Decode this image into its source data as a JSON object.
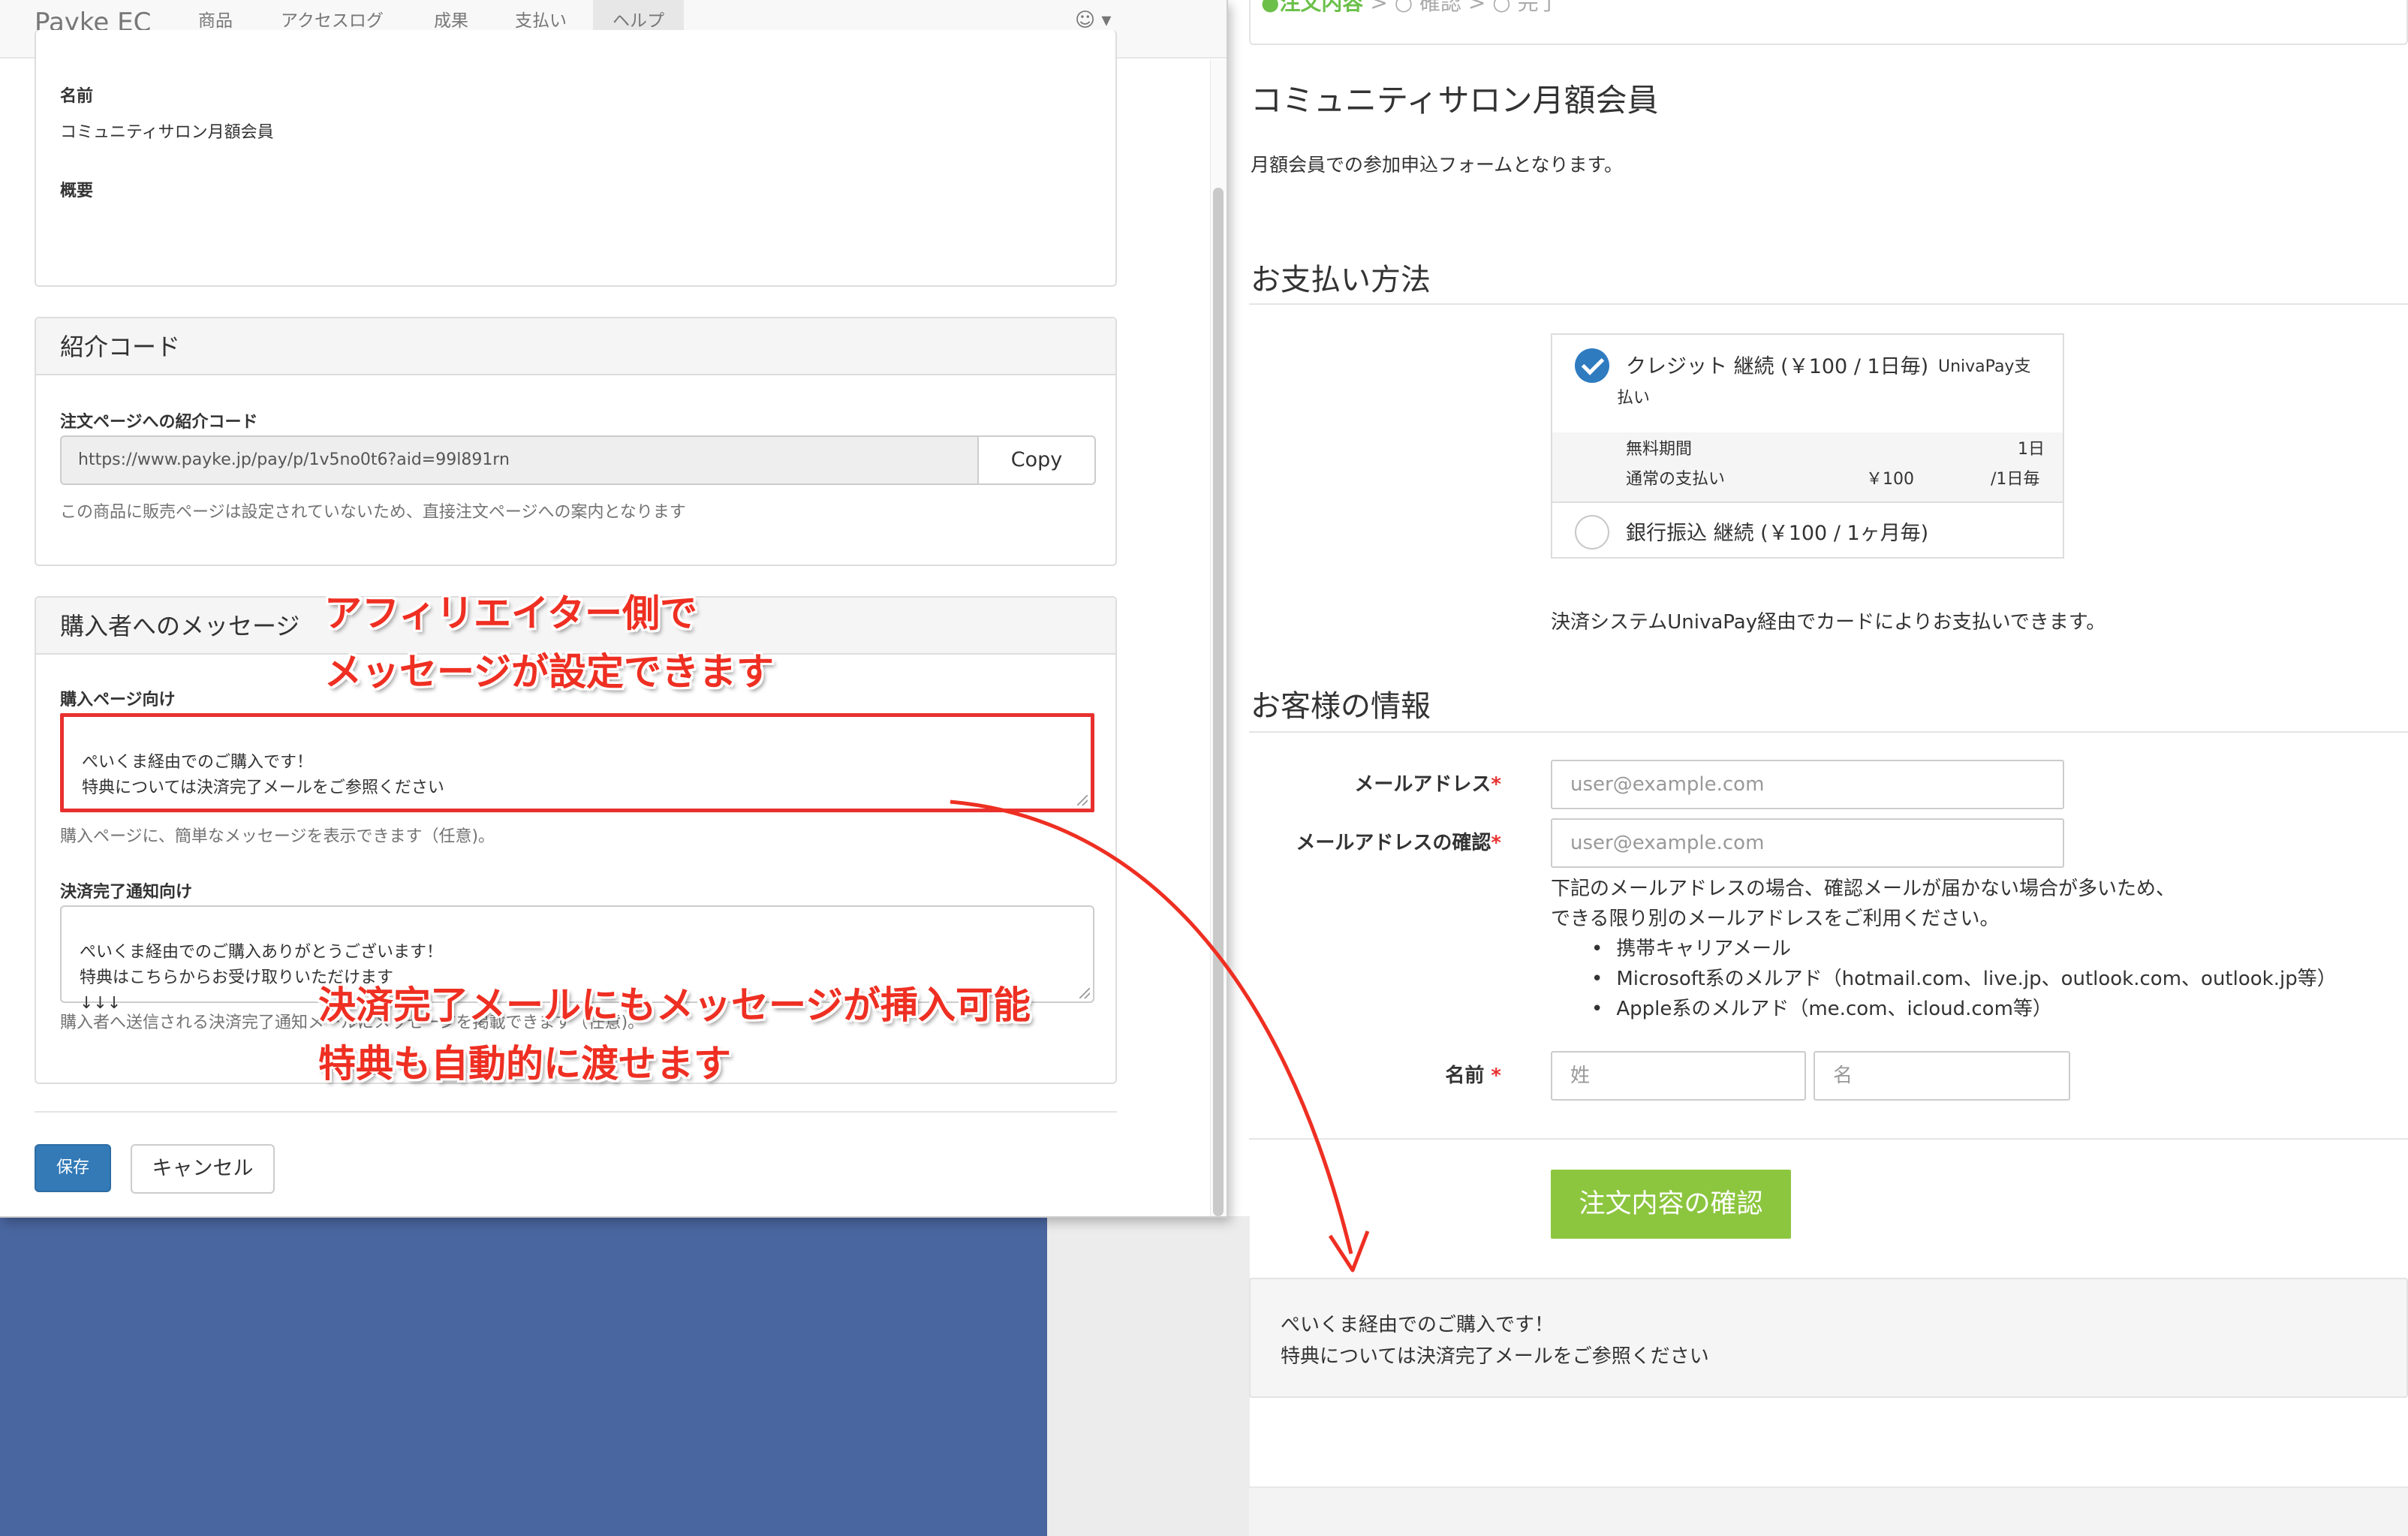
{
  "admin": {
    "brand": "Payke EC",
    "nav": [
      "商品",
      "アクセスログ",
      "成果",
      "支払い",
      "ヘルプ"
    ],
    "user_menu": "☺ ▾",
    "product": {
      "name_label": "名前",
      "name_value": "コミュニティサロン月額会員",
      "summary_label": "概要"
    },
    "referral": {
      "heading": "紹介コード",
      "order_page_label": "注文ページへの紹介コード",
      "url": "https://www.payke.jp/pay/p/1v5no0t6?aid=99l891rn",
      "copy_label": "Copy",
      "help": "この商品に販売ページは設定されていないため、直接注文ページへの案内となります"
    },
    "buyer_message": {
      "heading": "購入者へのメッセージ",
      "purchase_label": "購入ページ向け",
      "purchase_text": "ぺいくま経由でのご購入です！\n特典については決済完了メールをご参照ください",
      "purchase_help": "購入ページに、簡単なメッセージを表示できます（任意)。",
      "completion_label": "決済完了通知向け",
      "completion_text": "ぺいくま経由でのご購入ありがとうございます！\n特典はこちらからお受け取りいただけます\n↓↓↓",
      "completion_help": "購入者へ送信される決済完了通知メールにメッセージを掲載できます（任意)。"
    },
    "save_label": "保存",
    "cancel_label": "キャンセル"
  },
  "annotations": {
    "affiliate_message": "アフィリエイター側で\nメッセージが設定できます",
    "completion_mail": "決済完了メールにもメッセージが挿入可能\n特典も自動的に渡せます"
  },
  "order": {
    "steps": {
      "current": "●注文内容",
      "rest": "  > ○ 確認  > ○ 完了"
    },
    "product_title": "コミュニティサロン月額会員",
    "product_desc": "月額会員での参加申込フォームとなります。",
    "payment": {
      "title": "お支払い方法",
      "option1_label": "クレジット 継続 (￥100 / 1日毎)",
      "option1_provider_a": "UnivaPay支",
      "option1_provider_b": "払い",
      "trial_label": "無料期間",
      "trial_value": "1日",
      "regular_label": "通常の支払い",
      "regular_amount": "￥100",
      "regular_period": "/1日毎",
      "option2_label": "銀行振込 継続 (￥100 / 1ヶ月毎)",
      "note": "決済システムUnivaPay経由でカードによりお支払いできます。"
    },
    "customer": {
      "title": "お客様の情報",
      "email_label": "メールアドレス",
      "email_placeholder": "user@example.com",
      "email_confirm_label": "メールアドレスの確認",
      "email_confirm_placeholder": "user@example.com",
      "notice_line1": "下記のメールアドレスの場合、確認メールが届かない場合が多いため、",
      "notice_line2": "できる限り別のメールアドレスをご利用ください。",
      "notice_items": [
        "携帯キャリアメール",
        "Microsoft系のメルアド（hotmail.com、live.jp、outlook.com、outlook.jp等）",
        "Apple系のメルアド（me.com、icloud.com等）"
      ],
      "name_label": "名前",
      "last_name_placeholder": "姓",
      "first_name_placeholder": "名",
      "required_mark": "*"
    },
    "confirm_button": "注文内容の確認",
    "message": "ぺいくま経由でのご購入です！\n特典については決済完了メールをご参照ください"
  },
  "colors": {
    "annotation_red": "#ee2f22",
    "primary_blue": "#337ab7",
    "confirm_green": "#8cc63f",
    "background_blue": "#4a66a0"
  }
}
